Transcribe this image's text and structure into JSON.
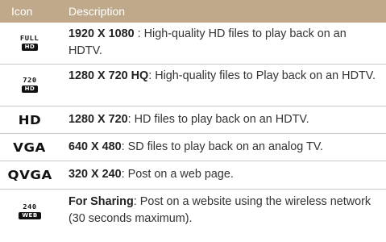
{
  "header": {
    "icon_col": "Icon",
    "desc_col": "Description"
  },
  "rows": [
    {
      "icon_top": "FULL",
      "icon_badge": "HD",
      "bold": "1920 X 1080",
      "text": " : High-quality HD files to play back on an HDTV."
    },
    {
      "icon_top": "720",
      "icon_badge": "HD",
      "bold": "1280 X 720 HQ",
      "text": ": High-quality files to Play back on an HDTV."
    },
    {
      "icon_big": "HD",
      "bold": "1280 X 720",
      "text": ": HD files to play back on an HDTV."
    },
    {
      "icon_big": "VGA",
      "bold": "640 X 480",
      "text": ": SD files to play back on an analog TV."
    },
    {
      "icon_big": "QVGA",
      "bold": "320 X 240",
      "text": ": Post on a web page."
    },
    {
      "icon_top": "240",
      "icon_badge": "WEB",
      "bold": "For Sharing",
      "text": ": Post on a website using the wireless network (30 seconds maximum)."
    }
  ],
  "colors": {
    "header_bg": "#bfa98a",
    "header_text": "#ffffff",
    "divider": "#c9c9c9"
  }
}
